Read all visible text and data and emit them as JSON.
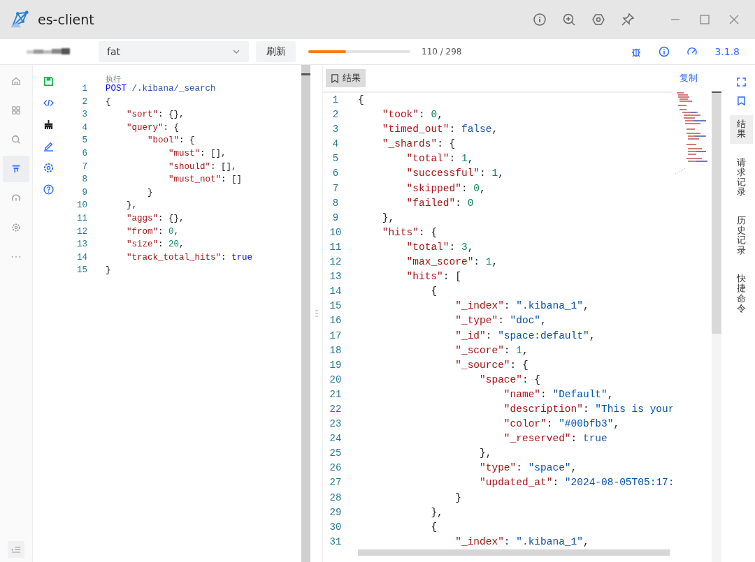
{
  "window": {
    "title": "es-client"
  },
  "toolbar": {
    "cluster": {
      "value": "fat"
    },
    "refresh_button": "刷新",
    "progress": {
      "level": 0.37,
      "reading": "110 / 298"
    },
    "version": "3.1.8"
  },
  "nav": [
    {
      "kind": "home",
      "selected": false
    },
    {
      "kind": "grid",
      "selected": false
    },
    {
      "kind": "search",
      "selected": false
    },
    {
      "kind": "filter",
      "selected": true
    },
    {
      "kind": "gauge",
      "selected": false
    },
    {
      "kind": "gear",
      "selected": false
    },
    {
      "kind": "more",
      "selected": false
    }
  ],
  "editor": {
    "run_label": "执行",
    "lines": [
      {
        "n": "1",
        "tokens": [
          {
            "kind": "kw",
            "text": "POST"
          },
          {
            "kind": "path",
            "text": " /.kibana/_search"
          }
        ]
      },
      {
        "n": "2",
        "tokens": [
          {
            "kind": "p",
            "text": "{"
          }
        ]
      },
      {
        "n": "3",
        "tokens": [
          {
            "kind": "key",
            "text": "    \"sort\""
          },
          {
            "kind": "p",
            "text": ": {},"
          }
        ]
      },
      {
        "n": "4",
        "tokens": [
          {
            "kind": "key",
            "text": "    \"query\""
          },
          {
            "kind": "p",
            "text": ": {"
          }
        ]
      },
      {
        "n": "5",
        "tokens": [
          {
            "kind": "key",
            "text": "        \"bool\""
          },
          {
            "kind": "p",
            "text": ": {"
          }
        ]
      },
      {
        "n": "6",
        "tokens": [
          {
            "kind": "key",
            "text": "            \"must\""
          },
          {
            "kind": "p",
            "text": ": [],"
          }
        ]
      },
      {
        "n": "7",
        "tokens": [
          {
            "kind": "key",
            "text": "            \"should\""
          },
          {
            "kind": "p",
            "text": ": [],"
          }
        ]
      },
      {
        "n": "8",
        "tokens": [
          {
            "kind": "key",
            "text": "            \"must_not\""
          },
          {
            "kind": "p",
            "text": ": []"
          }
        ]
      },
      {
        "n": "9",
        "tokens": [
          {
            "kind": "p",
            "text": "        }"
          }
        ]
      },
      {
        "n": "10",
        "tokens": [
          {
            "kind": "p",
            "text": "    },"
          }
        ]
      },
      {
        "n": "11",
        "tokens": [
          {
            "kind": "key",
            "text": "    \"aggs\""
          },
          {
            "kind": "p",
            "text": ": {},"
          }
        ]
      },
      {
        "n": "12",
        "tokens": [
          {
            "kind": "key",
            "text": "    \"from\""
          },
          {
            "kind": "p",
            "text": ": "
          },
          {
            "kind": "num",
            "text": "0"
          },
          {
            "kind": "p",
            "text": ","
          }
        ]
      },
      {
        "n": "13",
        "tokens": [
          {
            "kind": "key",
            "text": "    \"size\""
          },
          {
            "kind": "p",
            "text": ": "
          },
          {
            "kind": "num",
            "text": "20"
          },
          {
            "kind": "p",
            "text": ","
          }
        ]
      },
      {
        "n": "14",
        "tokens": [
          {
            "kind": "key",
            "text": "    \"track_total_hits\""
          },
          {
            "kind": "p",
            "text": ": "
          },
          {
            "kind": "bool",
            "text": "true"
          }
        ]
      },
      {
        "n": "15",
        "tokens": [
          {
            "kind": "p",
            "text": "}"
          }
        ]
      }
    ]
  },
  "result": {
    "tab": "结果",
    "copy_link": "复制",
    "lines": [
      {
        "n": "1",
        "tokens": [
          {
            "kind": "p",
            "text": "{"
          }
        ]
      },
      {
        "n": "2",
        "tokens": [
          {
            "kind": "key",
            "text": "    \"took\""
          },
          {
            "kind": "p",
            "text": ": "
          },
          {
            "kind": "num",
            "text": "0"
          },
          {
            "kind": "p",
            "text": ","
          }
        ]
      },
      {
        "n": "3",
        "tokens": [
          {
            "kind": "key",
            "text": "    \"timed_out\""
          },
          {
            "kind": "p",
            "text": ": "
          },
          {
            "kind": "bool",
            "text": "false"
          },
          {
            "kind": "p",
            "text": ","
          }
        ]
      },
      {
        "n": "4",
        "tokens": [
          {
            "kind": "key",
            "text": "    \"_shards\""
          },
          {
            "kind": "p",
            "text": ": {"
          }
        ]
      },
      {
        "n": "5",
        "tokens": [
          {
            "kind": "key",
            "text": "        \"total\""
          },
          {
            "kind": "p",
            "text": ": "
          },
          {
            "kind": "num",
            "text": "1"
          },
          {
            "kind": "p",
            "text": ","
          }
        ]
      },
      {
        "n": "6",
        "tokens": [
          {
            "kind": "key",
            "text": "        \"successful\""
          },
          {
            "kind": "p",
            "text": ": "
          },
          {
            "kind": "num",
            "text": "1"
          },
          {
            "kind": "p",
            "text": ","
          }
        ]
      },
      {
        "n": "7",
        "tokens": [
          {
            "kind": "key",
            "text": "        \"skipped\""
          },
          {
            "kind": "p",
            "text": ": "
          },
          {
            "kind": "num",
            "text": "0"
          },
          {
            "kind": "p",
            "text": ","
          }
        ]
      },
      {
        "n": "8",
        "tokens": [
          {
            "kind": "key",
            "text": "        \"failed\""
          },
          {
            "kind": "p",
            "text": ": "
          },
          {
            "kind": "num",
            "text": "0"
          }
        ]
      },
      {
        "n": "9",
        "tokens": [
          {
            "kind": "p",
            "text": "    },"
          }
        ]
      },
      {
        "n": "10",
        "tokens": [
          {
            "kind": "key",
            "text": "    \"hits\""
          },
          {
            "kind": "p",
            "text": ": {"
          }
        ]
      },
      {
        "n": "11",
        "tokens": [
          {
            "kind": "key",
            "text": "        \"total\""
          },
          {
            "kind": "p",
            "text": ": "
          },
          {
            "kind": "num",
            "text": "3"
          },
          {
            "kind": "p",
            "text": ","
          }
        ]
      },
      {
        "n": "12",
        "tokens": [
          {
            "kind": "key",
            "text": "        \"max_score\""
          },
          {
            "kind": "p",
            "text": ": "
          },
          {
            "kind": "num",
            "text": "1"
          },
          {
            "kind": "p",
            "text": ","
          }
        ]
      },
      {
        "n": "13",
        "tokens": [
          {
            "kind": "key",
            "text": "        \"hits\""
          },
          {
            "kind": "p",
            "text": ": ["
          }
        ]
      },
      {
        "n": "14",
        "tokens": [
          {
            "kind": "p",
            "text": "            {"
          }
        ]
      },
      {
        "n": "15",
        "tokens": [
          {
            "kind": "key",
            "text": "                \"_index\""
          },
          {
            "kind": "p",
            "text": ": "
          },
          {
            "kind": "str",
            "text": "\".kibana_1\""
          },
          {
            "kind": "p",
            "text": ","
          }
        ]
      },
      {
        "n": "16",
        "tokens": [
          {
            "kind": "key",
            "text": "                \"_type\""
          },
          {
            "kind": "p",
            "text": ": "
          },
          {
            "kind": "str",
            "text": "\"doc\""
          },
          {
            "kind": "p",
            "text": ","
          }
        ]
      },
      {
        "n": "17",
        "tokens": [
          {
            "kind": "key",
            "text": "                \"_id\""
          },
          {
            "kind": "p",
            "text": ": "
          },
          {
            "kind": "str",
            "text": "\"space:default\""
          },
          {
            "kind": "p",
            "text": ","
          }
        ]
      },
      {
        "n": "18",
        "tokens": [
          {
            "kind": "key",
            "text": "                \"_score\""
          },
          {
            "kind": "p",
            "text": ": "
          },
          {
            "kind": "num",
            "text": "1"
          },
          {
            "kind": "p",
            "text": ","
          }
        ]
      },
      {
        "n": "19",
        "tokens": [
          {
            "kind": "key",
            "text": "                \"_source\""
          },
          {
            "kind": "p",
            "text": ": {"
          }
        ]
      },
      {
        "n": "20",
        "tokens": [
          {
            "kind": "key",
            "text": "                    \"space\""
          },
          {
            "kind": "p",
            "text": ": {"
          }
        ]
      },
      {
        "n": "21",
        "tokens": [
          {
            "kind": "key",
            "text": "                        \"name\""
          },
          {
            "kind": "p",
            "text": ": "
          },
          {
            "kind": "str",
            "text": "\"Default\""
          },
          {
            "kind": "p",
            "text": ","
          }
        ]
      },
      {
        "n": "22",
        "tokens": [
          {
            "kind": "key",
            "text": "                        \"description\""
          },
          {
            "kind": "p",
            "text": ": "
          },
          {
            "kind": "str",
            "text": "\"This is your"
          }
        ]
      },
      {
        "n": "23",
        "tokens": [
          {
            "kind": "key",
            "text": "                        \"color\""
          },
          {
            "kind": "p",
            "text": ": "
          },
          {
            "kind": "str",
            "text": "\"#00bfb3\""
          },
          {
            "kind": "p",
            "text": ","
          }
        ]
      },
      {
        "n": "24",
        "tokens": [
          {
            "kind": "key",
            "text": "                        \"_reserved\""
          },
          {
            "kind": "p",
            "text": ": "
          },
          {
            "kind": "bool",
            "text": "true"
          }
        ]
      },
      {
        "n": "25",
        "tokens": [
          {
            "kind": "p",
            "text": "                    },"
          }
        ]
      },
      {
        "n": "26",
        "tokens": [
          {
            "kind": "key",
            "text": "                    \"type\""
          },
          {
            "kind": "p",
            "text": ": "
          },
          {
            "kind": "str",
            "text": "\"space\""
          },
          {
            "kind": "p",
            "text": ","
          }
        ]
      },
      {
        "n": "27",
        "tokens": [
          {
            "kind": "key",
            "text": "                    \"updated_at\""
          },
          {
            "kind": "p",
            "text": ": "
          },
          {
            "kind": "str",
            "text": "\"2024-08-05T05:17:"
          }
        ]
      },
      {
        "n": "28",
        "tokens": [
          {
            "kind": "p",
            "text": "                }"
          }
        ]
      },
      {
        "n": "29",
        "tokens": [
          {
            "kind": "p",
            "text": "            },"
          }
        ]
      },
      {
        "n": "30",
        "tokens": [
          {
            "kind": "p",
            "text": "            {"
          }
        ]
      },
      {
        "n": "31",
        "tokens": [
          {
            "kind": "key",
            "text": "                \"_index\""
          },
          {
            "kind": "p",
            "text": ": "
          },
          {
            "kind": "str",
            "text": "\".kibana_1\""
          },
          {
            "kind": "p",
            "text": ","
          }
        ]
      }
    ]
  },
  "side_tabs": [
    {
      "label": "结果",
      "selected": true
    },
    {
      "label": "请求记录",
      "selected": false
    },
    {
      "label": "历史记录",
      "selected": false
    },
    {
      "label": "快捷命令",
      "selected": false
    }
  ]
}
